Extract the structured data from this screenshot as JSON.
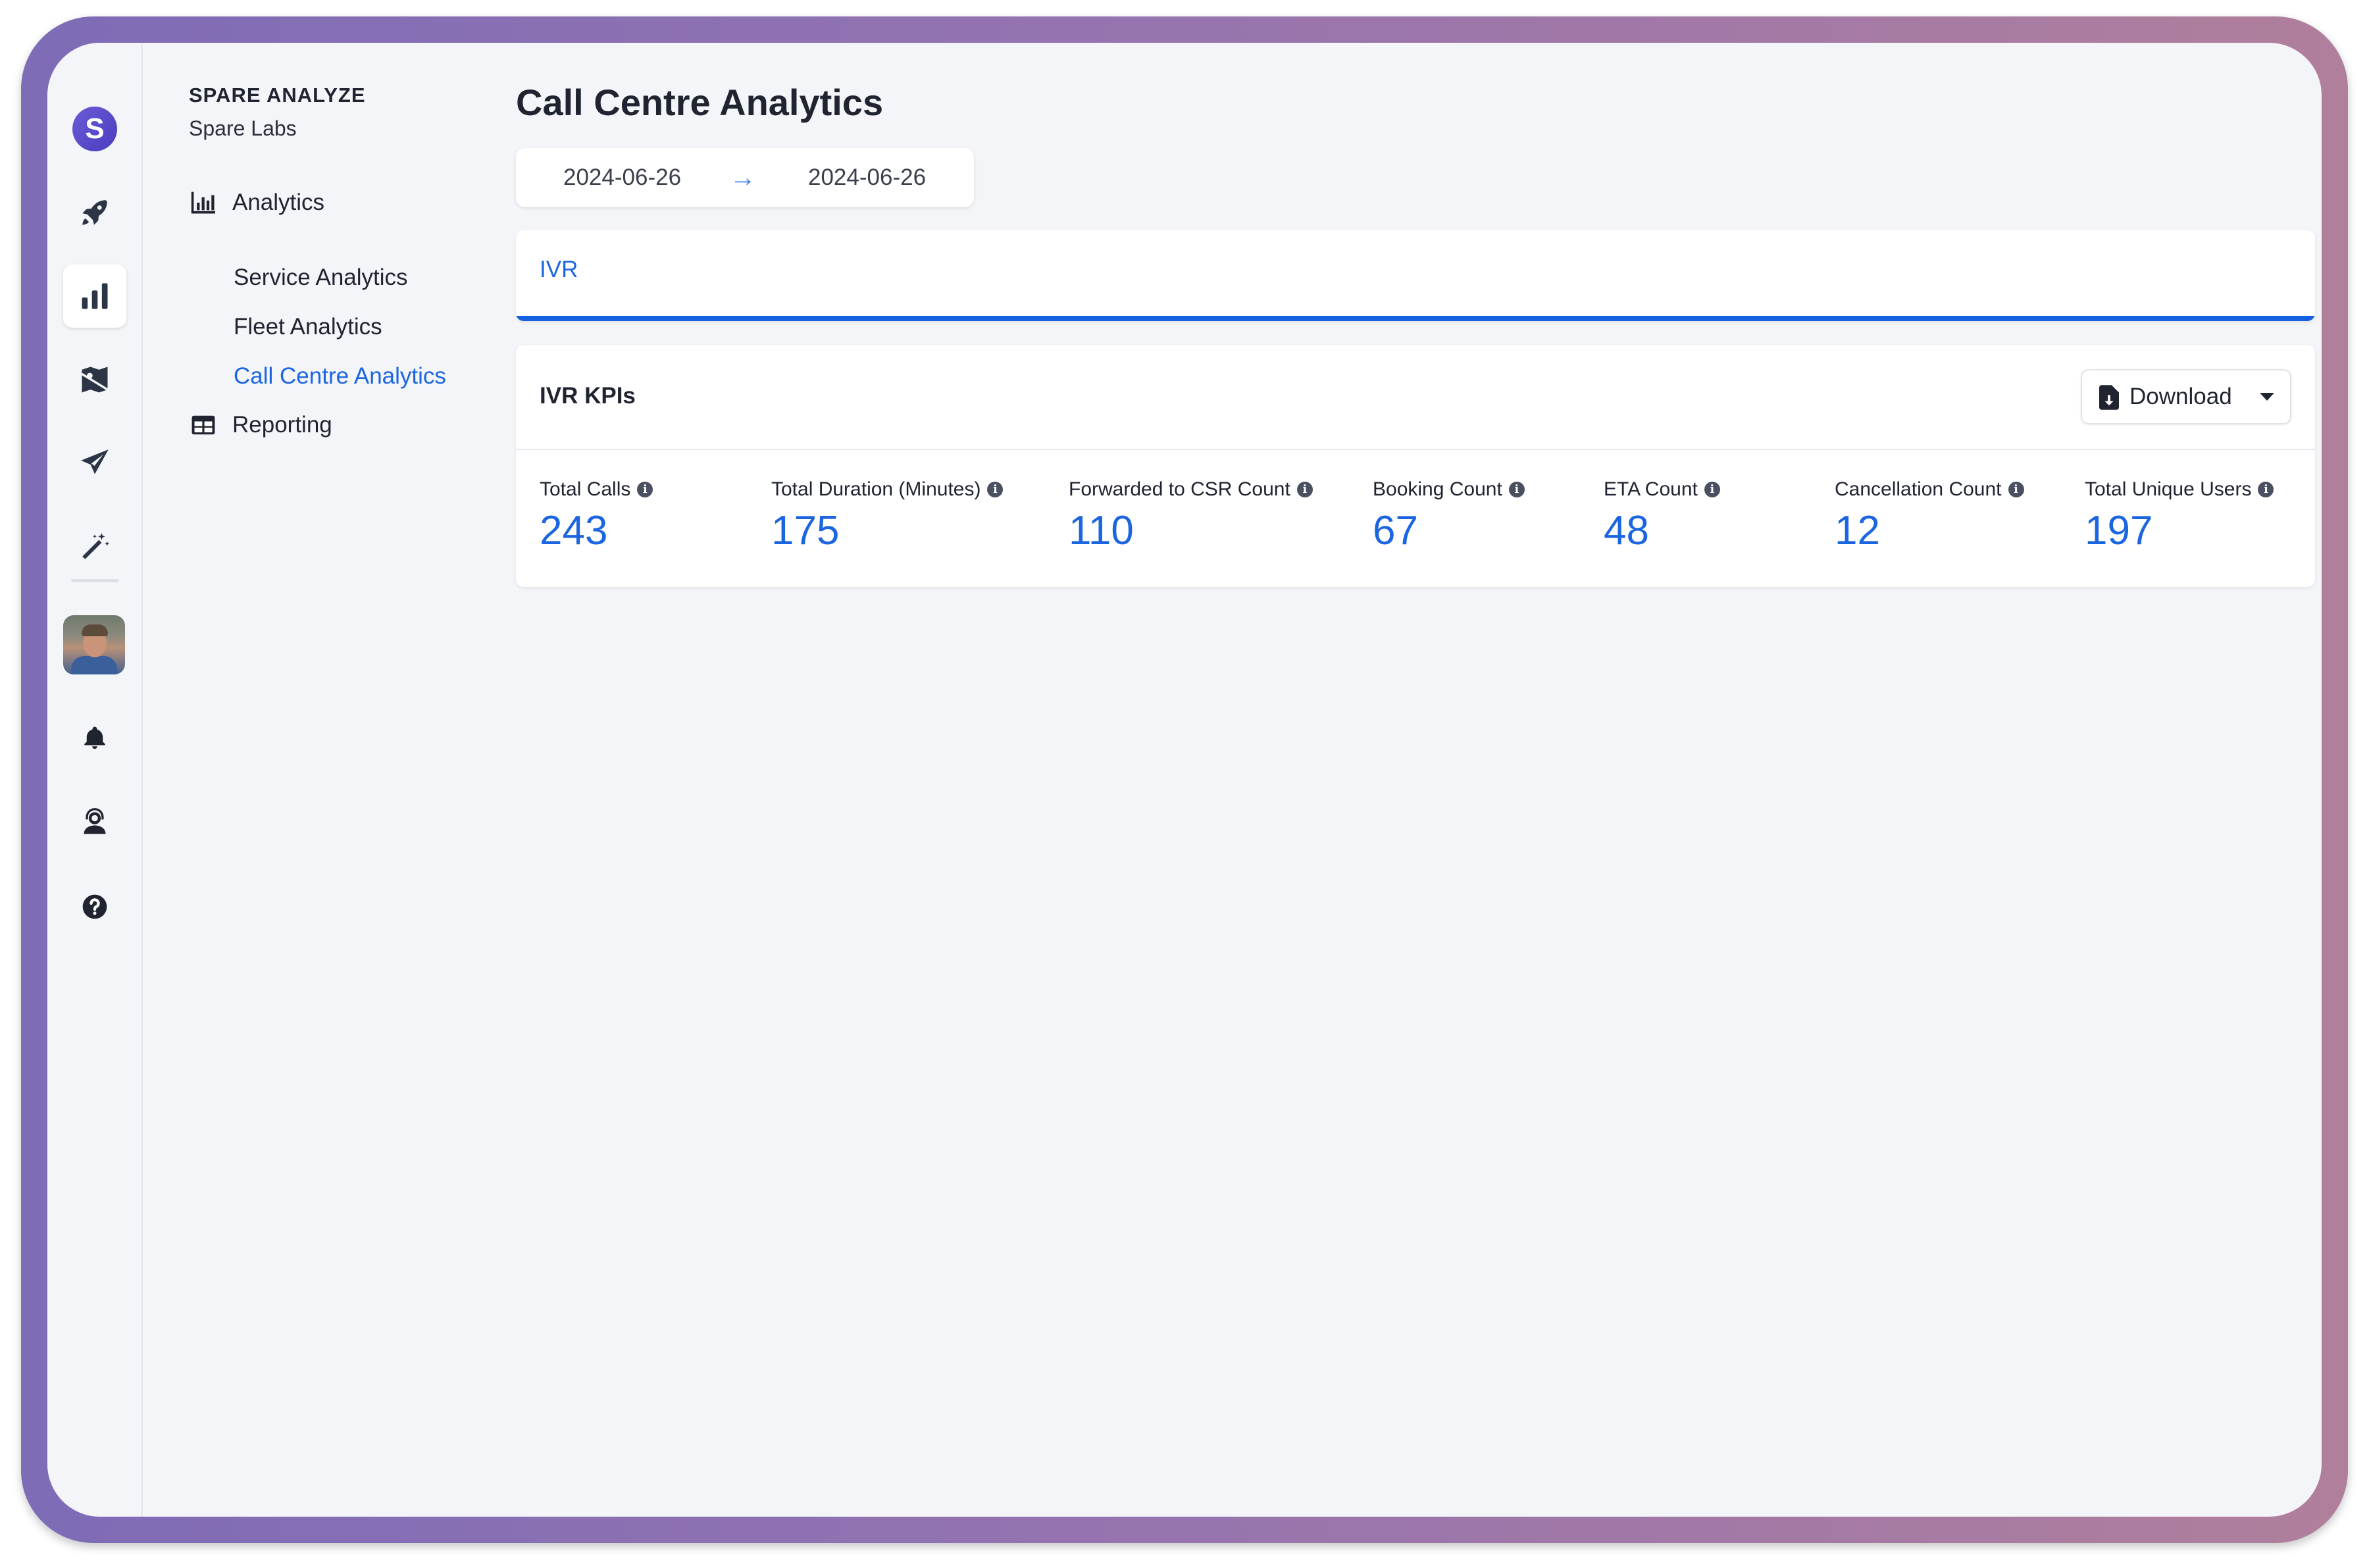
{
  "app": {
    "brand_title": "SPARE ANALYZE",
    "brand_subtitle": "Spare Labs",
    "logo_letter": "S"
  },
  "rail": {
    "icons": [
      "spare-logo-icon",
      "rocket-icon",
      "bar-chart-icon",
      "map-icon",
      "paper-plane-icon",
      "magic-wand-icon",
      "user-avatar",
      "bell-icon",
      "support-agent-icon",
      "help-icon"
    ],
    "active": "bar-chart-icon",
    "accent_color": "#4b3dbf"
  },
  "nav": {
    "analytics_label": "Analytics",
    "items": [
      {
        "label": "Service Analytics"
      },
      {
        "label": "Fleet Analytics"
      },
      {
        "label": "Call Centre Analytics"
      }
    ],
    "active_item": "Call Centre Analytics",
    "reporting_label": "Reporting"
  },
  "main": {
    "title": "Call Centre Analytics",
    "date_range": {
      "start": "2024-06-26",
      "arrow": "→",
      "end": "2024-06-26"
    },
    "tabs": [
      {
        "label": "IVR",
        "active": true
      }
    ],
    "kpi_section": {
      "title": "IVR KPIs",
      "download_label": "Download",
      "kpis": [
        {
          "label": "Total Calls",
          "value": "243"
        },
        {
          "label": "Total Duration (Minutes)",
          "value": "175"
        },
        {
          "label": "Forwarded to CSR Count",
          "value": "110"
        },
        {
          "label": "Booking Count",
          "value": "67"
        },
        {
          "label": "ETA Count",
          "value": "48"
        },
        {
          "label": "Cancellation Count",
          "value": "12"
        },
        {
          "label": "Total Unique Users",
          "value": "197"
        }
      ]
    }
  },
  "colors": {
    "link_blue": "#1b66e0",
    "text_dark": "#1f2430",
    "background": "#f4f5f9"
  }
}
